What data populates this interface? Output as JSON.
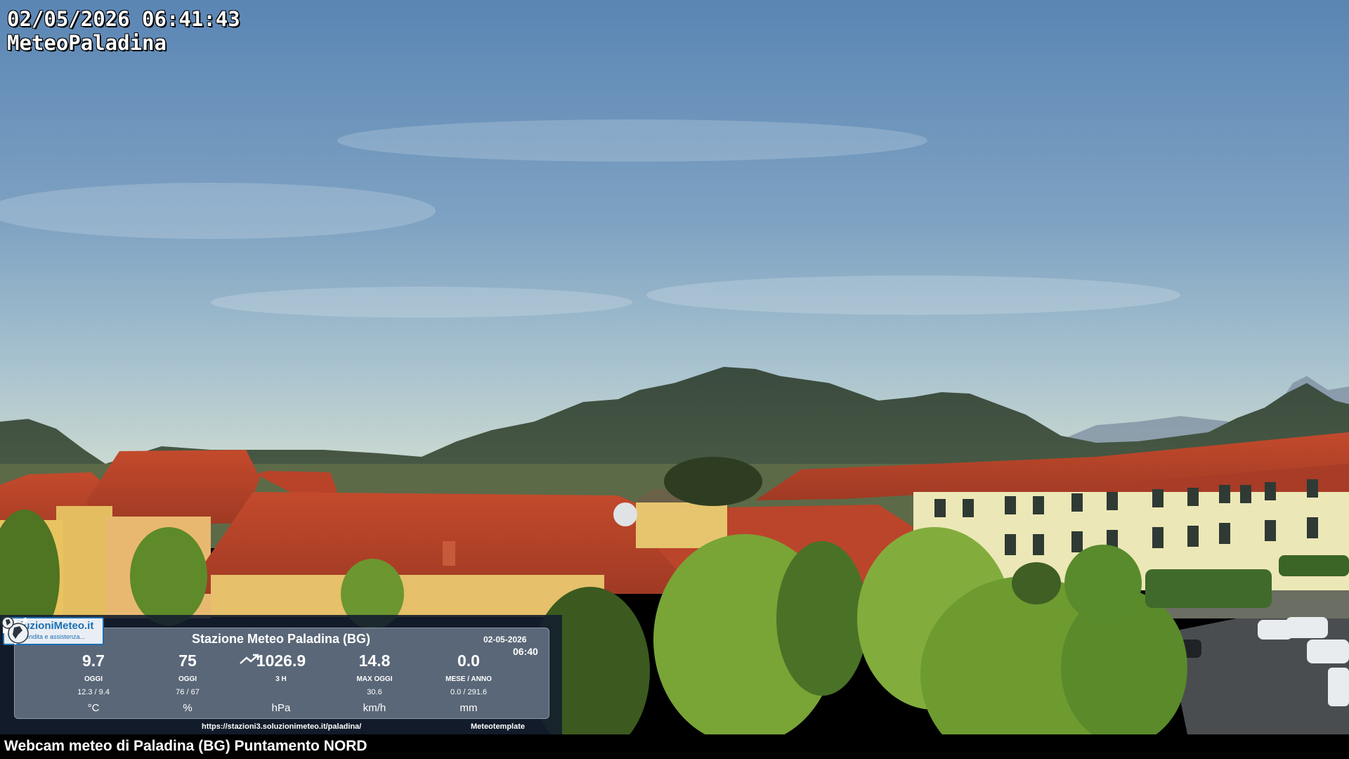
{
  "overlay": {
    "datetime": "02/05/2026 06:41:43",
    "station": "MeteoPaladina"
  },
  "panel": {
    "logo_name": "SoluzioniMeteo.it",
    "logo_tagline": "vendita e assistenza...",
    "title": "Stazione Meteo Paladina (BG)",
    "date": "02-05-2026",
    "time": "06:40",
    "metrics": [
      {
        "value": "9.7",
        "label": "OGGI",
        "sub": "12.3 / 9.4",
        "unit": "°C"
      },
      {
        "value": "75",
        "label": "OGGI",
        "sub": "76 / 67",
        "unit": "%"
      },
      {
        "value": "1026.9",
        "label": "3 H",
        "sub": "",
        "unit": "hPa",
        "icon": "trend-up-icon"
      },
      {
        "value": "14.8",
        "label": "MAX OGGI",
        "sub": "30.6",
        "unit": "km/h"
      },
      {
        "value": "0.0",
        "label": "MESE / ANNO",
        "sub": "0.0 / 291.6",
        "unit": "mm"
      }
    ],
    "url": "https://stazioni3.soluzionimeteo.it/paladina/",
    "credit": "Meteotemplate"
  },
  "caption": "Webcam meteo di Paladina (BG) Puntamento NORD",
  "colors": {
    "sky_top": "#5b86b5",
    "sky_horizon": "#c9d8d2",
    "mountains": "#3b4d3e",
    "roof": "#b8432a",
    "wall": "#e9c56a",
    "trees": "#6f9a2e"
  }
}
